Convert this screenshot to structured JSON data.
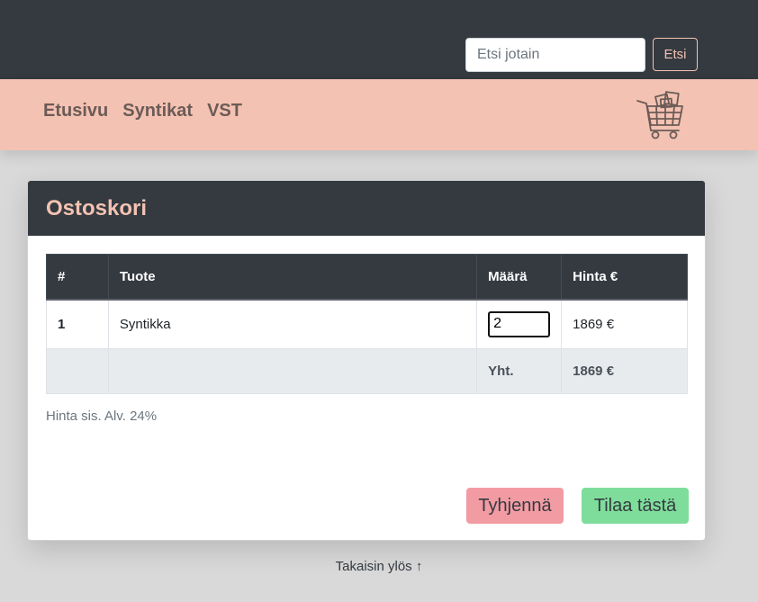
{
  "header": {
    "search": {
      "placeholder": "Etsi jotain",
      "button_label": "Etsi"
    }
  },
  "nav": {
    "links": [
      "Etusivu",
      "Syntikat",
      "VST"
    ],
    "cart_icon": "shopping-cart-icon"
  },
  "cart": {
    "title": "Ostoskori",
    "columns": [
      "#",
      "Tuote",
      "Määrä",
      "Hinta €"
    ],
    "rows": [
      {
        "index": "1",
        "product": "Syntikka",
        "quantity": "2",
        "price": "1869 €"
      }
    ],
    "total_label": "Yht.",
    "total_value": "1869 €",
    "vat_note": "Hinta sis. Alv. 24%",
    "clear_label": "Tyhjennä",
    "order_label": "Tilaa tästä"
  },
  "footer": {
    "back_to_top": "Takaisin ylös ↑"
  },
  "colors": {
    "dark": "#343a40",
    "accent": "#f4c2b2",
    "danger_soft": "#f29ba3",
    "success_soft": "#7fdd9b"
  }
}
